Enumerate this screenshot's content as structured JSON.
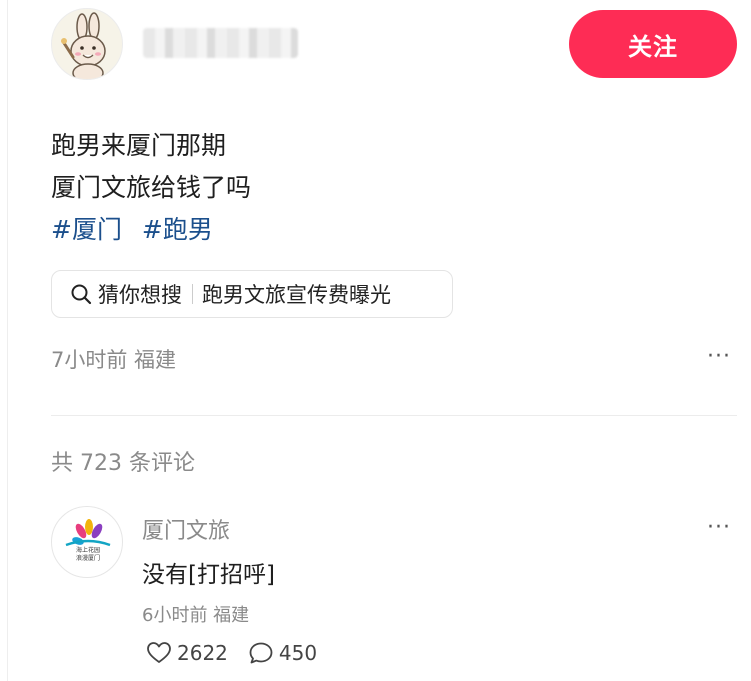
{
  "post": {
    "follow_label": "关注",
    "lines": [
      "跑男来厦门那期",
      "厦门文旅给钱了吗"
    ],
    "tags": [
      "#厦门",
      "#跑男"
    ],
    "suggest_label": "猜你想搜",
    "suggest_query": "跑男文旅宣传费曝光",
    "meta": "7小时前 福建",
    "more": "···"
  },
  "comments_header": "共 723 条评论",
  "comment": {
    "author": "厦门文旅",
    "avatar_text": "海上花园 浪漫厦门",
    "text": "没有[打招呼]",
    "meta": "6小时前 福建",
    "likes": "2622",
    "replies": "450",
    "more": "···"
  },
  "colors": {
    "accent": "#fe2c55",
    "tag": "#1b4f8c",
    "muted": "#8a8a8a"
  },
  "icons": {
    "search": "search-icon",
    "like": "heart-icon",
    "reply": "comment-icon",
    "more": "more-icon"
  }
}
